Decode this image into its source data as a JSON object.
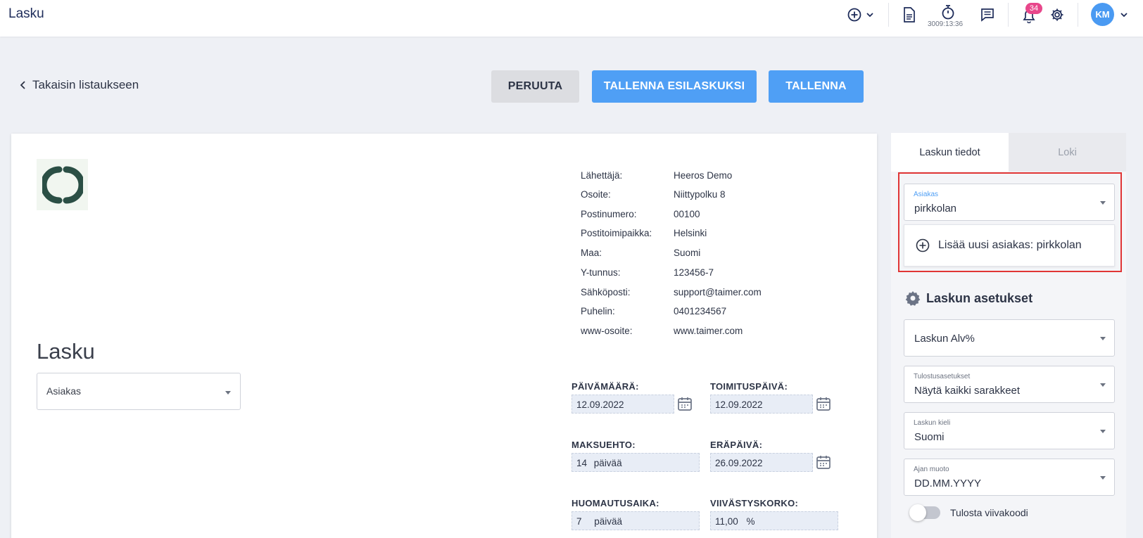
{
  "header": {
    "title": "Lasku",
    "timer": "3009:13:36",
    "notification_count": "34",
    "avatar_initials": "KM"
  },
  "actions": {
    "back_label": "Takaisin listaukseen",
    "cancel_label": "PERUUTA",
    "save_draft_label": "TALLENNA ESILASKUKSI",
    "save_label": "TALLENNA"
  },
  "sender": [
    {
      "label": "Lähettäjä:",
      "value": "Heeros Demo"
    },
    {
      "label": "Osoite:",
      "value": "Niittypolku 8"
    },
    {
      "label": "Postinumero:",
      "value": "00100"
    },
    {
      "label": "Postitoimipaikka:",
      "value": "Helsinki"
    },
    {
      "label": "Maa:",
      "value": "Suomi"
    },
    {
      "label": "Y-tunnus:",
      "value": "123456-7"
    },
    {
      "label": "Sähköposti:",
      "value": "support@taimer.com"
    },
    {
      "label": "Puhelin:",
      "value": "0401234567"
    },
    {
      "label": "www-osoite:",
      "value": "www.taimer.com"
    }
  ],
  "invoice": {
    "heading": "Lasku",
    "customer_placeholder": "Asiakas",
    "date_label": "PÄIVÄMÄÄRÄ:",
    "date_value": "12.09.2022",
    "delivery_label": "TOIMITUSPÄIVÄ:",
    "delivery_value": "12.09.2022",
    "terms_label": "MAKSUEHTO:",
    "terms_value": "14",
    "terms_unit": "päivää",
    "due_label": "ERÄPÄIVÄ:",
    "due_value": "26.09.2022",
    "notice_label": "HUOMAUTUSAIKA:",
    "notice_value": "7",
    "notice_unit": "päivää",
    "interest_label": "VIIVÄSTYSKORKO:",
    "interest_value": "11,00",
    "interest_unit": "%"
  },
  "panel": {
    "tab_details": "Laskun tiedot",
    "tab_log": "Loki",
    "customer_label": "Asiakas",
    "customer_value": "pirkkolan",
    "add_customer": "Lisää uusi asiakas: pirkkolan",
    "settings_heading": "Laskun asetukset",
    "vat_value": "Laskun Alv%",
    "print_label": "Tulostusasetukset",
    "print_value": "Näytä kaikki sarakkeet",
    "lang_label": "Laskun kieli",
    "lang_value": "Suomi",
    "time_label": "Ajan muoto",
    "time_value": "DD.MM.YYYY",
    "barcode_label": "Tulosta viivakoodi"
  },
  "colors": {
    "primary": "#4f9ff5",
    "highlight_frame": "#e03535",
    "badge": "#e8478b",
    "logo": "#2b4f45"
  }
}
